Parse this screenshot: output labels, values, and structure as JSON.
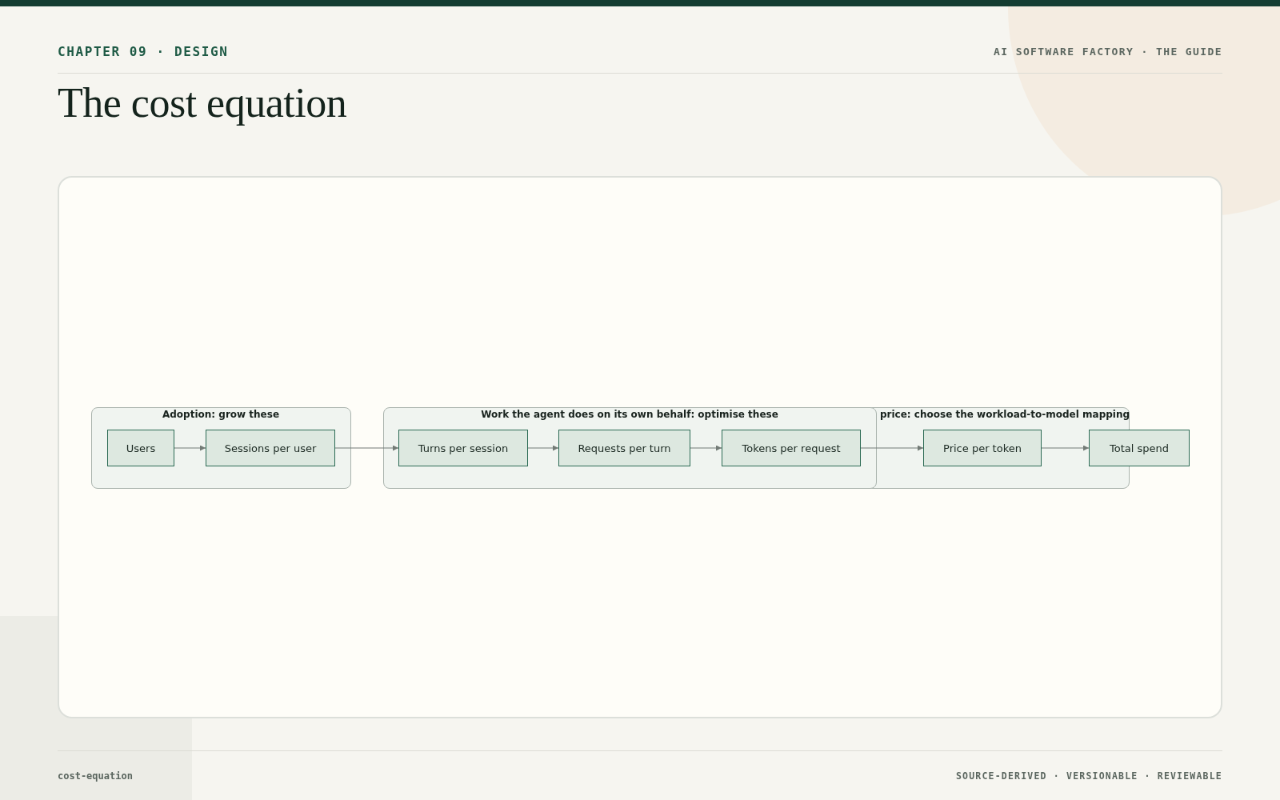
{
  "header": {
    "chapter": "CHAPTER 09 · DESIGN",
    "book": "AI SOFTWARE FACTORY · THE GUIDE"
  },
  "title": "The cost equation",
  "diagram": {
    "groups": [
      {
        "label": "Adoption: grow these"
      },
      {
        "label": "Work the agent does on its own behalf: optimise these"
      },
      {
        "label": "price: choose the workload-to-model mapping"
      }
    ],
    "nodes": [
      {
        "label": "Users"
      },
      {
        "label": "Sessions per user"
      },
      {
        "label": "Turns per session"
      },
      {
        "label": "Requests per turn"
      },
      {
        "label": "Tokens per request"
      },
      {
        "label": "Price per token"
      },
      {
        "label": "Total spend"
      }
    ]
  },
  "footer": {
    "slug": "cost-equation",
    "tagline": "SOURCE-DERIVED · VERSIONABLE · REVIEWABLE"
  }
}
